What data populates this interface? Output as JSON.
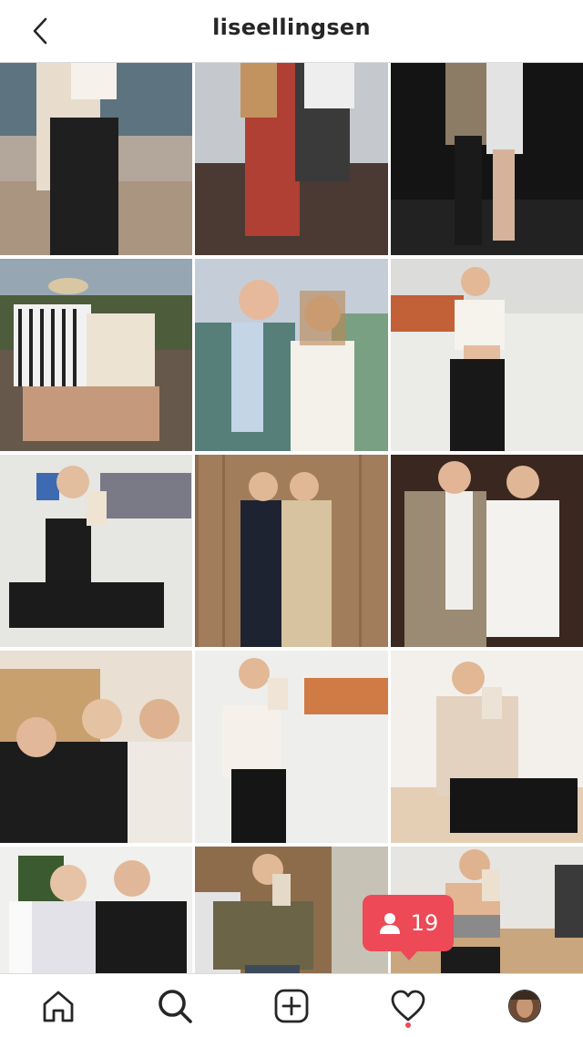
{
  "header": {
    "title": "liseellingsen",
    "back_icon": "chevron-left-icon"
  },
  "grid": {
    "tiles": [
      {
        "desc": "woman in coat on rocks by sea",
        "colors": [
          "#6f7d86",
          "#b3a69a",
          "#2b2b2b"
        ]
      },
      {
        "desc": "two people on balcony",
        "colors": [
          "#c2c6cc",
          "#7a4a3a",
          "#3a3a3a"
        ]
      },
      {
        "desc": "couple at night",
        "colors": [
          "#151515",
          "#8a7c68",
          "#dcdcdc"
        ]
      },
      {
        "desc": "couple sitting on rock",
        "colors": [
          "#7f8f9c",
          "#e7e2d9",
          "#5a4a3a"
        ]
      },
      {
        "desc": "couple on balcony in suits",
        "colors": [
          "#c3cdd8",
          "#5f8d86",
          "#f2eee7"
        ]
      },
      {
        "desc": "woman in gym crop top",
        "colors": [
          "#e9e9e6",
          "#f5f1ea",
          "#1d1d1d"
        ]
      },
      {
        "desc": "woman squatting in gym selfie",
        "colors": [
          "#e6e6e3",
          "#1c1c1c",
          "#d9b89c"
        ]
      },
      {
        "desc": "two women in gowns",
        "colors": [
          "#a27d5c",
          "#1c2230",
          "#d8c3a0"
        ]
      },
      {
        "desc": "couple at party",
        "colors": [
          "#3e2a22",
          "#9b8a74",
          "#f0eeea"
        ]
      },
      {
        "desc": "three women smiling",
        "colors": [
          "#e9e0d3",
          "#1c1c1c",
          "#e8d6c2"
        ]
      },
      {
        "desc": "woman selfie in gym",
        "colors": [
          "#eeeeec",
          "#f4efe8",
          "#161616"
        ]
      },
      {
        "desc": "woman mirror selfie turtleneck",
        "colors": [
          "#f3f0ec",
          "#e3d2bf",
          "#151515"
        ]
      },
      {
        "desc": "two women indoors",
        "colors": [
          "#f0f0ee",
          "#e2e2e8",
          "#1a1a1a"
        ]
      },
      {
        "desc": "woman hallway mirror selfie",
        "colors": [
          "#8d6c4c",
          "#6b6446",
          "#3d4a5c"
        ]
      },
      {
        "desc": "woman in sports bra gym",
        "colors": [
          "#c9b08e",
          "#7a7a7a",
          "#1b1b1b"
        ]
      }
    ]
  },
  "notification": {
    "count": "19",
    "icon": "person-icon",
    "color": "#ed4956"
  },
  "nav": {
    "items": [
      {
        "name": "home",
        "icon": "home-icon"
      },
      {
        "name": "search",
        "icon": "search-icon"
      },
      {
        "name": "new-post",
        "icon": "plus-square-icon"
      },
      {
        "name": "activity",
        "icon": "heart-icon"
      },
      {
        "name": "profile",
        "icon": "profile-avatar-icon"
      }
    ]
  }
}
